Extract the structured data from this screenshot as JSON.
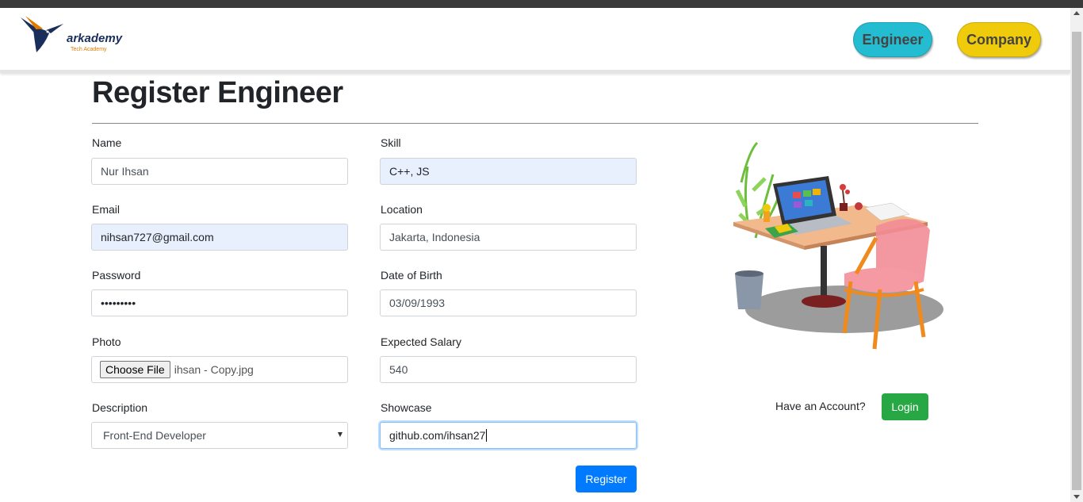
{
  "brand": {
    "name": "arkademy",
    "tagline": "Tech Academy"
  },
  "nav": {
    "engineer_label": "Engineer",
    "company_label": "Company"
  },
  "page": {
    "title": "Register Engineer"
  },
  "form": {
    "name": {
      "label": "Name",
      "value": "Nur Ihsan"
    },
    "email": {
      "label": "Email",
      "value": "nihsan727@gmail.com"
    },
    "password": {
      "label": "Password",
      "value": "•••••••••"
    },
    "photo": {
      "label": "Photo",
      "button_label": "Choose File",
      "file_name": "ihsan - Copy.jpg"
    },
    "description": {
      "label": "Description",
      "value": "Front-End Developer"
    },
    "skill": {
      "label": "Skill",
      "value": "C++, JS"
    },
    "location": {
      "label": "Location",
      "value": "Jakarta, Indonesia"
    },
    "dob": {
      "label": "Date of Birth",
      "value": "03/09/1993"
    },
    "salary": {
      "label": "Expected Salary",
      "value": "540"
    },
    "showcase": {
      "label": "Showcase",
      "value": "github.com/ihsan27"
    },
    "register_label": "Register"
  },
  "account": {
    "prompt": "Have an Account?",
    "login_label": "Login"
  },
  "colors": {
    "engineer_pill": "#24bcd0",
    "company_pill": "#f0cb0c",
    "primary": "#007bff",
    "success": "#28a745",
    "autofill": "#e8f0fe"
  }
}
